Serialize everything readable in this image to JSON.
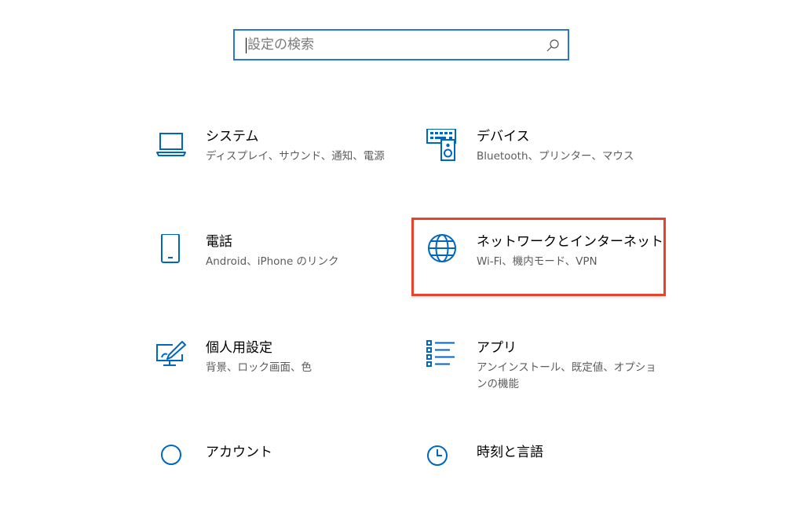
{
  "search": {
    "placeholder": "設定の検索",
    "icon": "search-icon",
    "border_color": "#2b78d4"
  },
  "accent_color": "#0067c0",
  "highlight_color": "#e5432a",
  "tiles": [
    {
      "icon": "laptop-icon",
      "title": "システム",
      "desc": "ディスプレイ、サウンド、通知、電源"
    },
    {
      "icon": "keyboard-speaker-icon",
      "title": "デバイス",
      "desc": "Bluetooth、プリンター、マウス"
    },
    {
      "icon": "phone-icon",
      "title": "電話",
      "desc": "Android、iPhone のリンク"
    },
    {
      "icon": "globe-icon",
      "title": "ネットワークとインターネット",
      "desc": "Wi-Fi、機内モード、VPN"
    },
    {
      "icon": "paintbrush-monitor-icon",
      "title": "個人用設定",
      "desc": "背景、ロック画面、色"
    },
    {
      "icon": "app-list-icon",
      "title": "アプリ",
      "desc": "アンインストール、既定値、オプションの機能"
    },
    {
      "icon": "person-icon",
      "title": "アカウント",
      "desc": ""
    },
    {
      "icon": "clock-language-icon",
      "title": "時刻と言語",
      "desc": ""
    }
  ]
}
